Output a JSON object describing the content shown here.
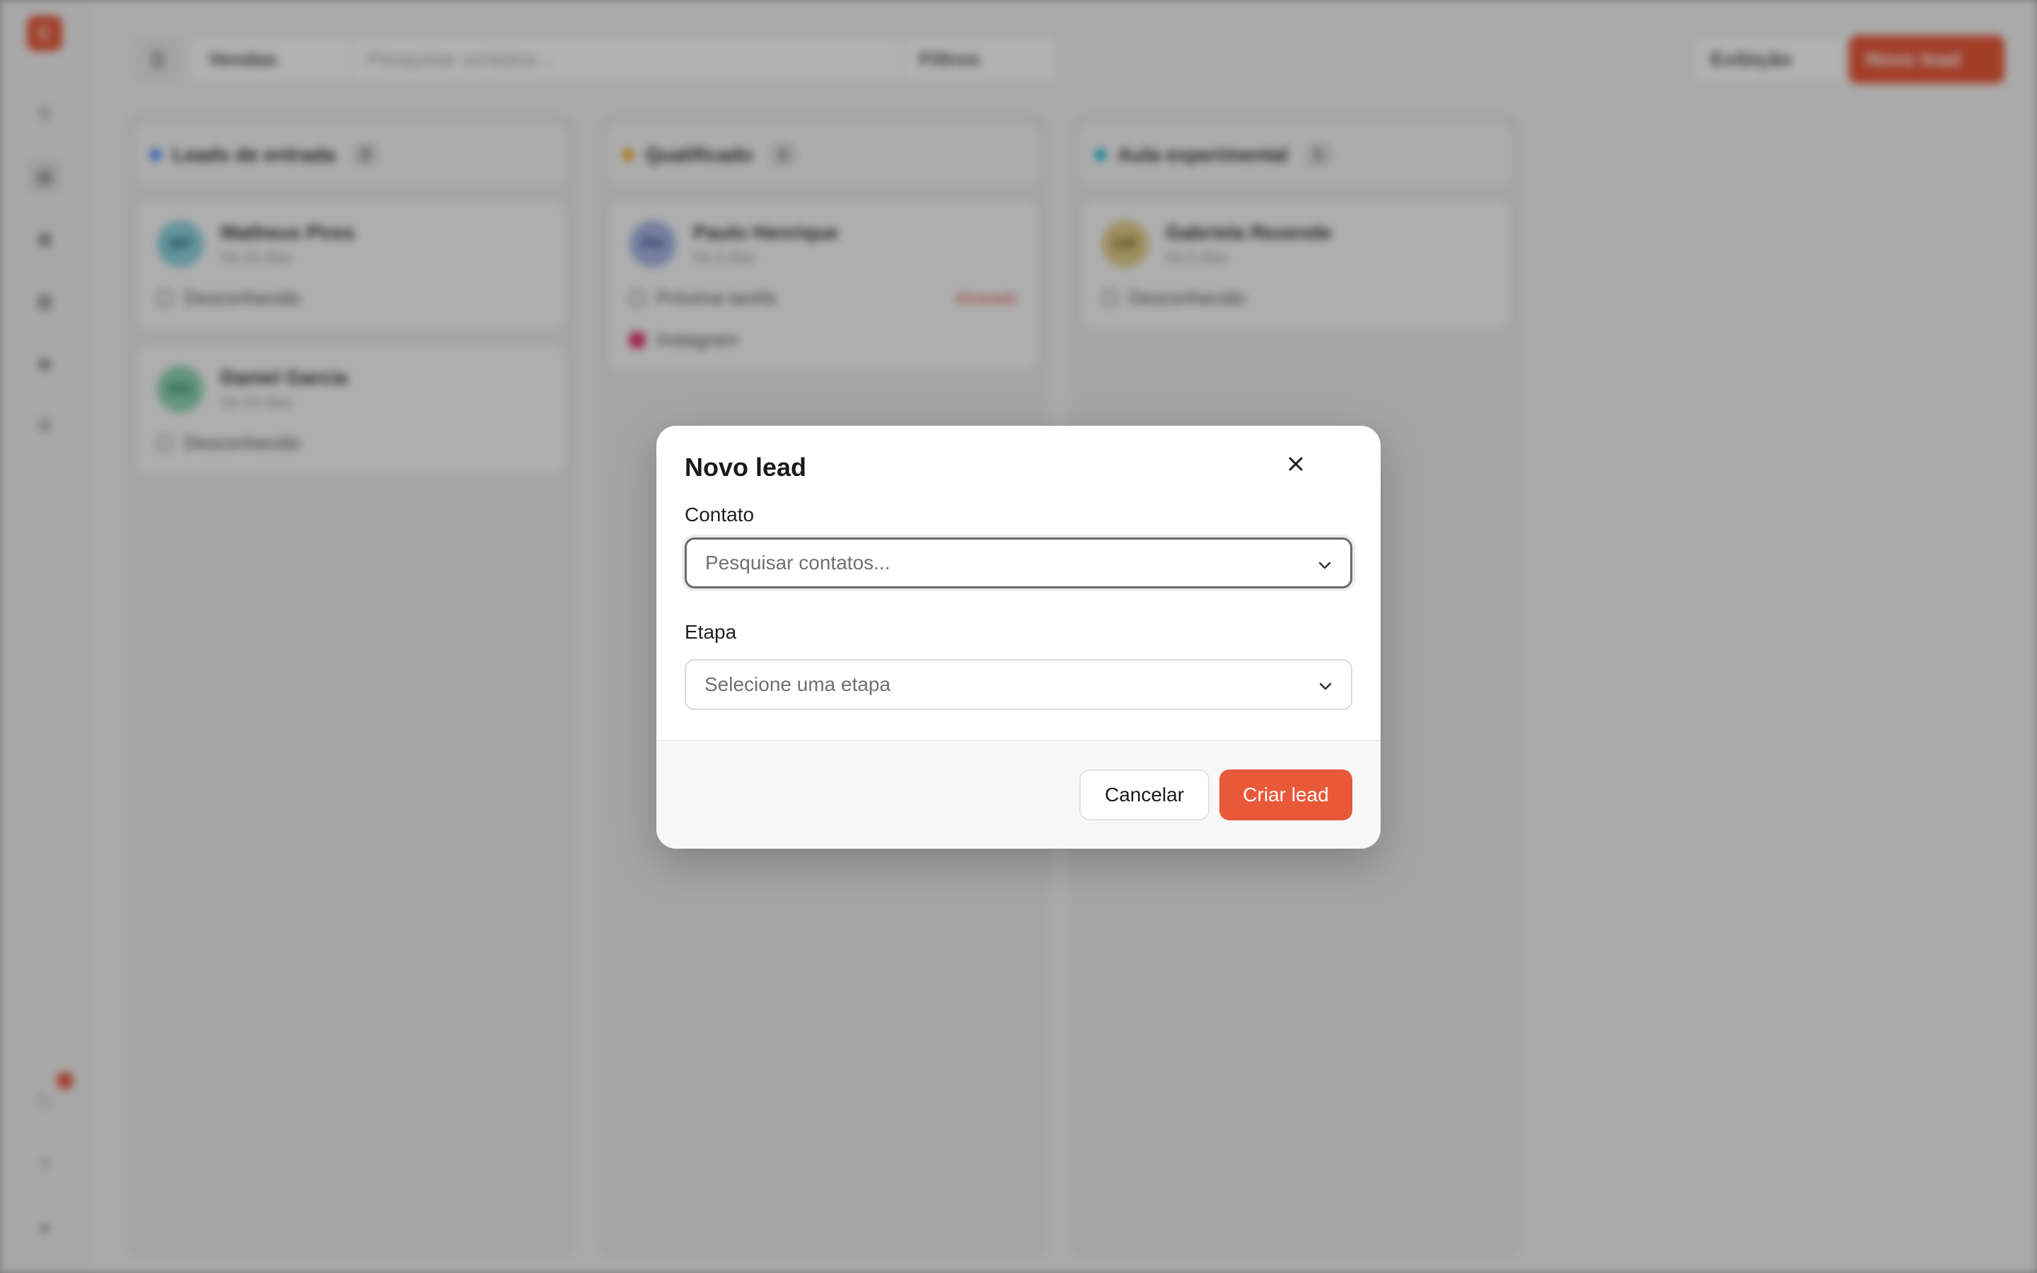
{
  "app": {
    "logo_letter": "C",
    "topbar": {
      "pipeline_select": "Vendas",
      "search_placeholder": "Pesquisar contatos...",
      "filter_label": "Filtros",
      "fields_label": "Exibição",
      "new_lead_label": "Novo lead"
    },
    "columns": [
      {
        "name": "Leads de entrada",
        "count": "2",
        "color": "#3b82f6",
        "cards": [
          {
            "initials": "MP",
            "name": "Matheus Pires",
            "sub": "há 25 dias",
            "tag": "Desconhecido",
            "avatar_color": "#8fd3e0"
          },
          {
            "initials": "DG",
            "name": "Daniel Garcia",
            "sub": "há 19 dias",
            "tag": "Desconhecido",
            "avatar_color": "#8fd6b5"
          }
        ]
      },
      {
        "name": "Qualificado",
        "count": "1",
        "color": "#f59e0b",
        "cards": [
          {
            "initials": "PH",
            "name": "Paulo Henrique",
            "sub": "há 3 dias",
            "tag": "Próxima tarefa",
            "tag_extra": "Atrasado",
            "source": "Instagram",
            "avatar_color": "#a9b7e6"
          }
        ]
      },
      {
        "name": "Aula experimental",
        "count": "1",
        "color": "#06b6d4",
        "cards": [
          {
            "initials": "GR",
            "name": "Gabriela Rezende",
            "sub": "há 5 dias",
            "tag": "Desconhecido",
            "avatar_color": "#e0cf8a"
          }
        ]
      }
    ]
  },
  "modal": {
    "title": "Novo lead",
    "contact": {
      "label": "Contato",
      "placeholder": "Pesquisar contatos..."
    },
    "stage": {
      "label": "Etapa",
      "placeholder": "Selecione uma etapa"
    },
    "cancel_label": "Cancelar",
    "submit_label": "Criar lead",
    "accent_color": "#e8593a"
  }
}
